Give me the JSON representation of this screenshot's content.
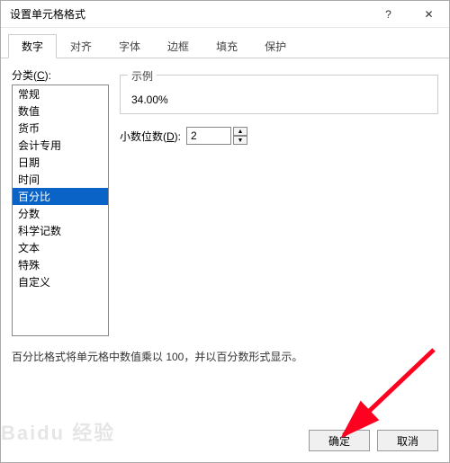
{
  "titlebar": {
    "title": "设置单元格格式",
    "help": "?",
    "close": "✕"
  },
  "tabs": [
    "数字",
    "对齐",
    "字体",
    "边框",
    "填充",
    "保护"
  ],
  "activeTabIndex": 0,
  "category": {
    "label_prefix": "分类(",
    "label_hotkey": "C",
    "label_suffix": "):",
    "items": [
      "常规",
      "数值",
      "货币",
      "会计专用",
      "日期",
      "时间",
      "百分比",
      "分数",
      "科学记数",
      "文本",
      "特殊",
      "自定义"
    ],
    "selectedIndex": 6
  },
  "sample": {
    "legend": "示例",
    "value": "34.00%"
  },
  "decimal": {
    "label_prefix": "小数位数(",
    "label_hotkey": "D",
    "label_suffix": "):",
    "value": "2",
    "up": "▲",
    "down": "▼"
  },
  "description": "百分比格式将单元格中数值乘以 100，并以百分数形式显示。",
  "buttons": {
    "ok": "确定",
    "cancel": "取消"
  },
  "watermark": "Baidu 经验"
}
